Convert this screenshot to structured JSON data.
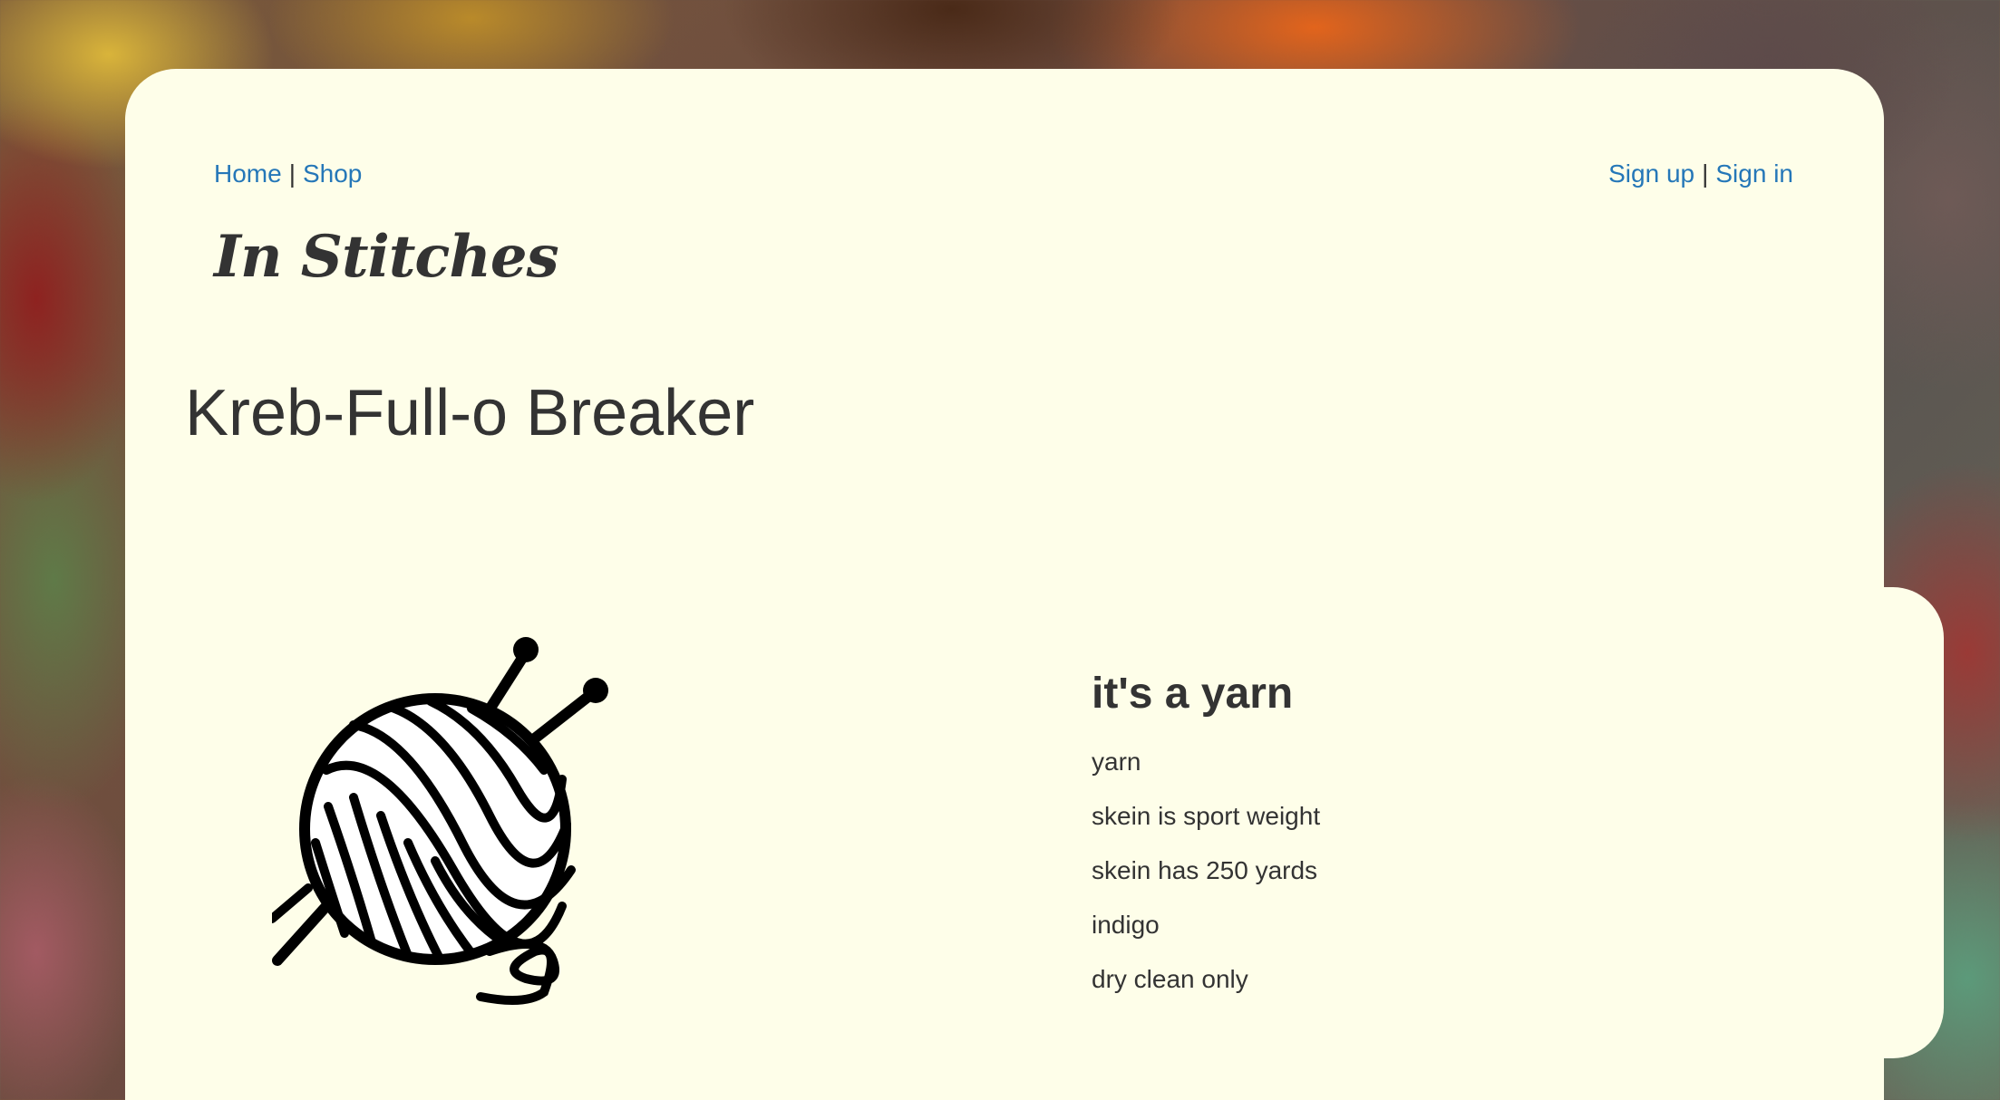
{
  "nav": {
    "home": "Home",
    "shop": "Shop",
    "separator": "|",
    "sign_up": "Sign up",
    "sign_in": "Sign in"
  },
  "site": {
    "logo_text": "In Stitches"
  },
  "product": {
    "title": "Kreb-Full-o Breaker",
    "image_icon": "yarn-ball-with-needles",
    "description_heading": "it's a yarn",
    "attributes": [
      "yarn",
      "skein is sport weight",
      "skein has 250 yards",
      "indigo",
      "dry clean only"
    ]
  },
  "colors": {
    "link": "#2577b8",
    "card_background": "#fefee9",
    "text": "#333333"
  }
}
